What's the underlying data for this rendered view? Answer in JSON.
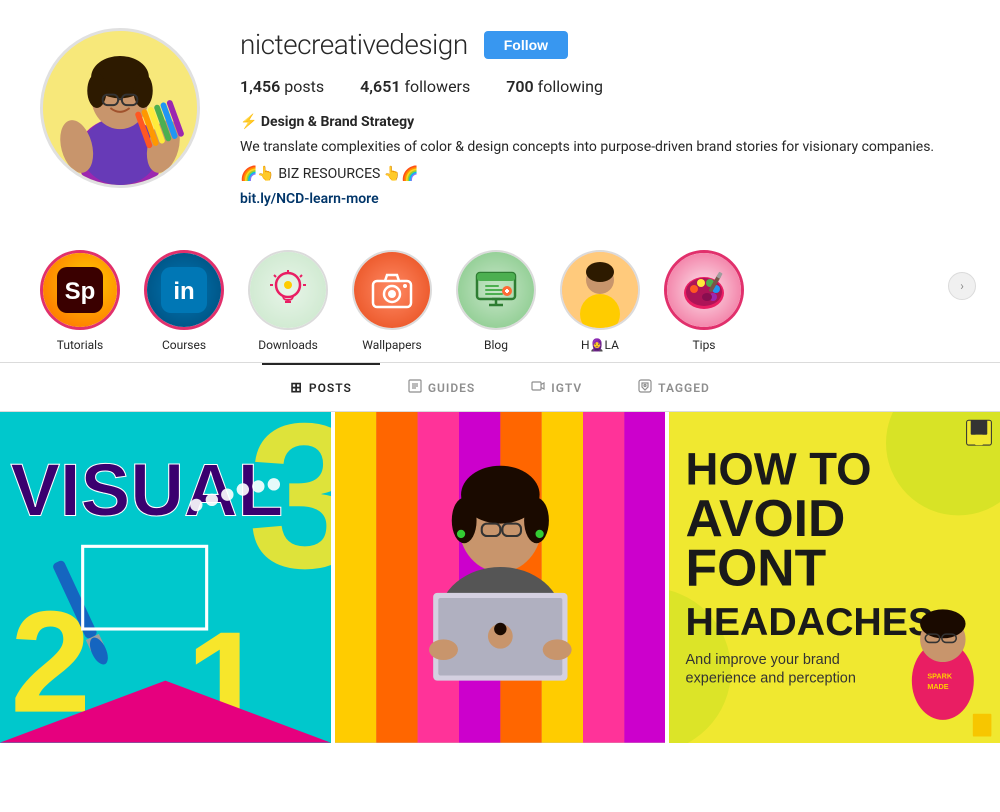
{
  "profile": {
    "username": "nictecreativedesign",
    "follow_label": "Follow",
    "stats": {
      "posts_count": "1,456",
      "posts_label": "posts",
      "followers_count": "4,651",
      "followers_label": "followers",
      "following_count": "700",
      "following_label": "following"
    },
    "bio": {
      "name_emoji": "⚡",
      "name": "Design & Brand Strategy",
      "text": "We translate complexities of color & design concepts into purpose-driven brand stories for visionary companies.",
      "link_label": "🌈👆 BIZ RESOURCES 👆🌈",
      "link_text": "bit.ly/NCD-learn-more",
      "link_href": "http://bit.ly/NCD-learn-more"
    }
  },
  "highlights": [
    {
      "id": "tutorials",
      "label": "Tutorials",
      "icon": "Sp",
      "border": "pink"
    },
    {
      "id": "courses",
      "label": "Courses",
      "icon": "in",
      "border": "pink"
    },
    {
      "id": "downloads",
      "label": "Downloads",
      "icon": "💡",
      "border": "normal"
    },
    {
      "id": "wallpapers",
      "label": "Wallpapers",
      "icon": "📷",
      "border": "normal"
    },
    {
      "id": "blog",
      "label": "Blog",
      "icon": "🖥",
      "border": "normal"
    },
    {
      "id": "hola",
      "label": "HOLA",
      "icon": "👩",
      "border": "normal"
    },
    {
      "id": "tips",
      "label": "Tips",
      "icon": "🎨",
      "border": "pink"
    }
  ],
  "tabs": [
    {
      "id": "posts",
      "label": "POSTS",
      "icon": "⊞",
      "active": true
    },
    {
      "id": "guides",
      "label": "GUIDES",
      "icon": "📋",
      "active": false
    },
    {
      "id": "igtv",
      "label": "IGTV",
      "icon": "📱",
      "active": false
    },
    {
      "id": "tagged",
      "label": "TAGGED",
      "icon": "🏷",
      "active": false
    }
  ],
  "posts": [
    {
      "id": "post1",
      "type": "visual321",
      "alt": "Visual 3 2 1 post with paintbrush"
    },
    {
      "id": "post2",
      "type": "person_laptop",
      "alt": "Person holding laptop"
    },
    {
      "id": "post3",
      "type": "font_headaches",
      "title": "HOW TO AVOID FONT HEADACHES",
      "subtitle": "And improve your brand experience and perception"
    }
  ]
}
